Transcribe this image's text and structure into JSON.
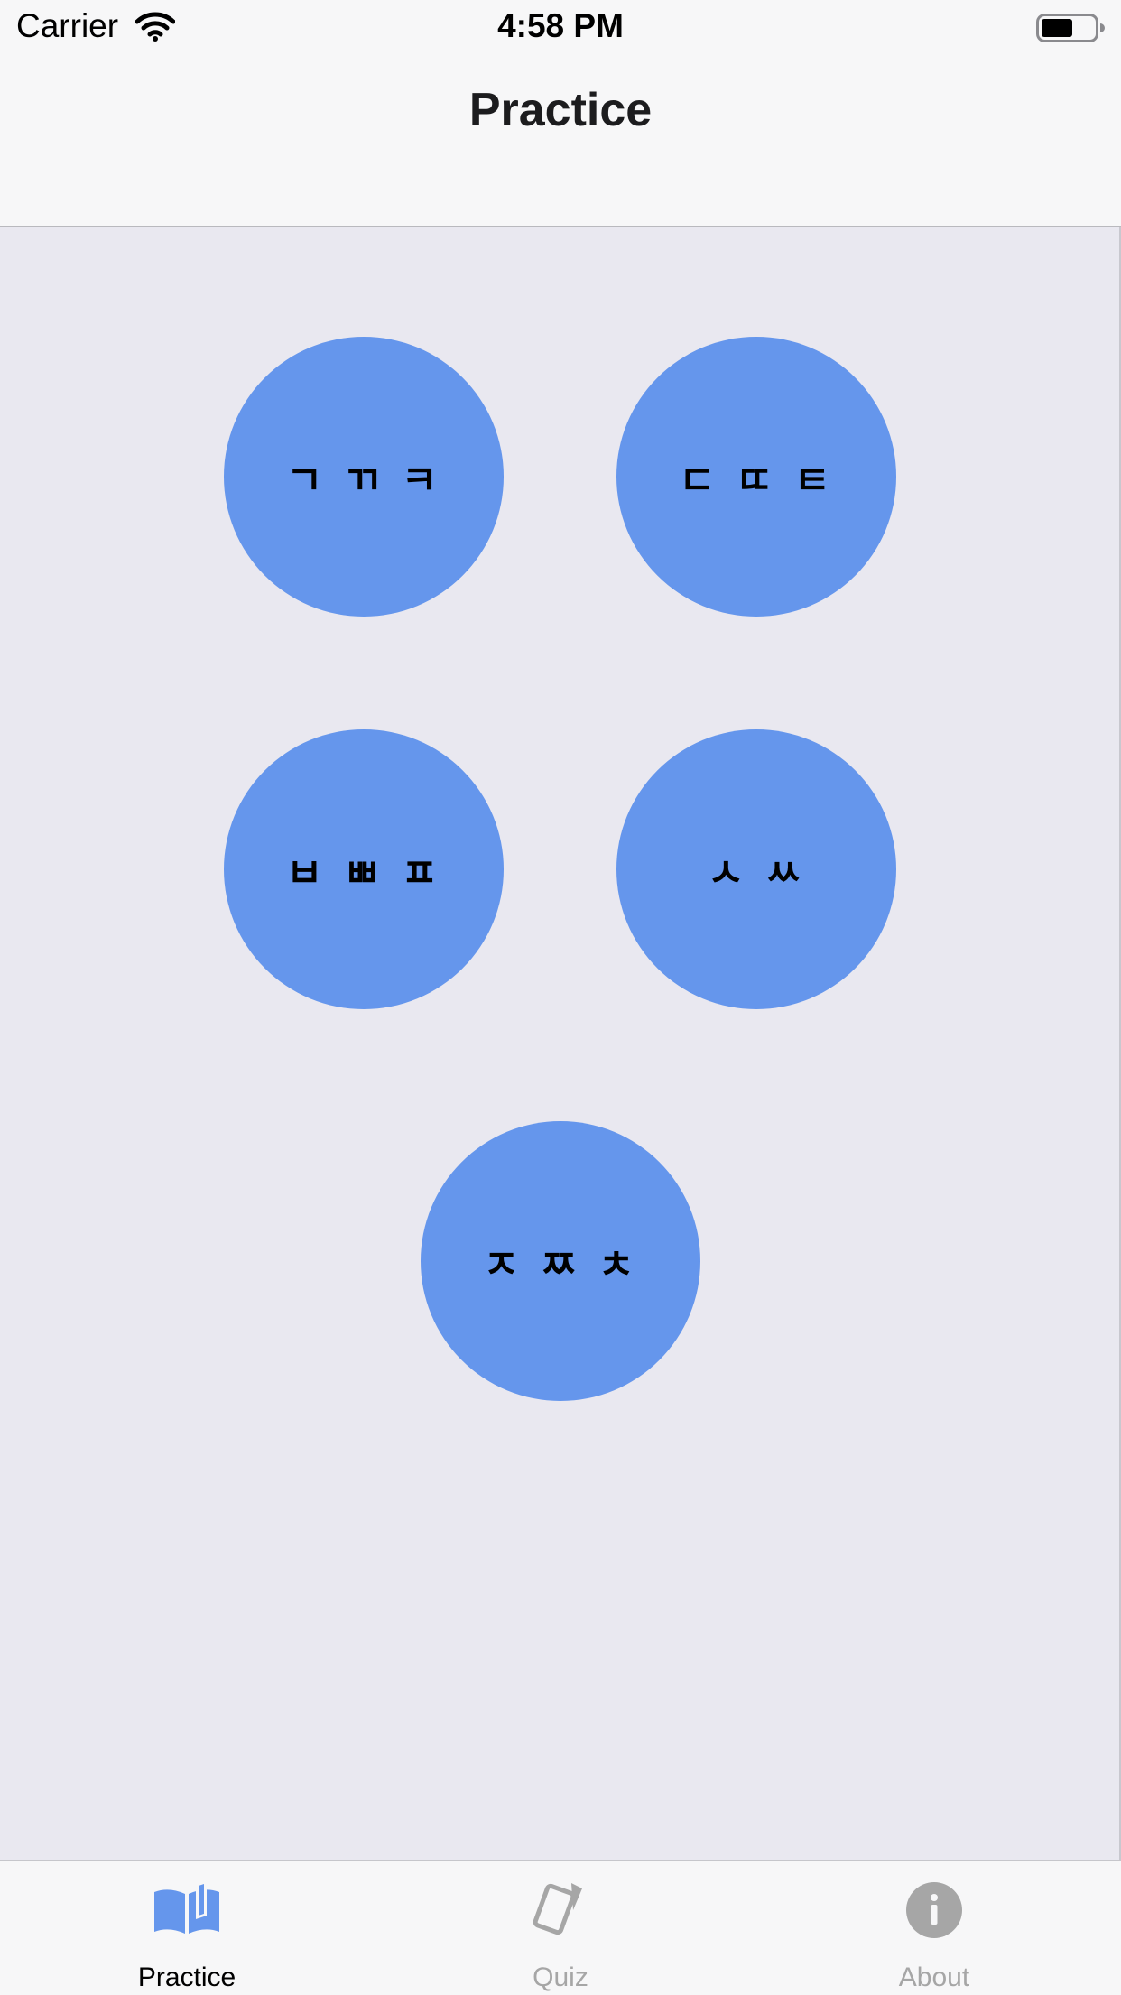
{
  "status_bar": {
    "carrier": "Carrier",
    "time": "4:58 PM"
  },
  "nav": {
    "title": "Practice"
  },
  "buttons": [
    {
      "label": "ㄱ ㄲ ㅋ"
    },
    {
      "label": "ㄷ ㄸ ㅌ"
    },
    {
      "label": "ㅂ ㅃ ㅍ"
    },
    {
      "label": "ㅅ ㅆ"
    },
    {
      "label": "ㅈ ㅉ ㅊ"
    }
  ],
  "tabs": [
    {
      "label": "Practice",
      "icon": "book-icon",
      "selected": true
    },
    {
      "label": "Quiz",
      "icon": "cards-icon",
      "selected": false
    },
    {
      "label": "About",
      "icon": "info-icon",
      "selected": false
    }
  ],
  "colors": {
    "accent": "#6596ec",
    "background": "#e9e8f0",
    "bar": "#f7f7f8",
    "tab_selected": "#000000",
    "tab_unselected": "#a6a6a6",
    "icon_selected": "#6596ec",
    "icon_unselected": "#a6a6a6"
  }
}
